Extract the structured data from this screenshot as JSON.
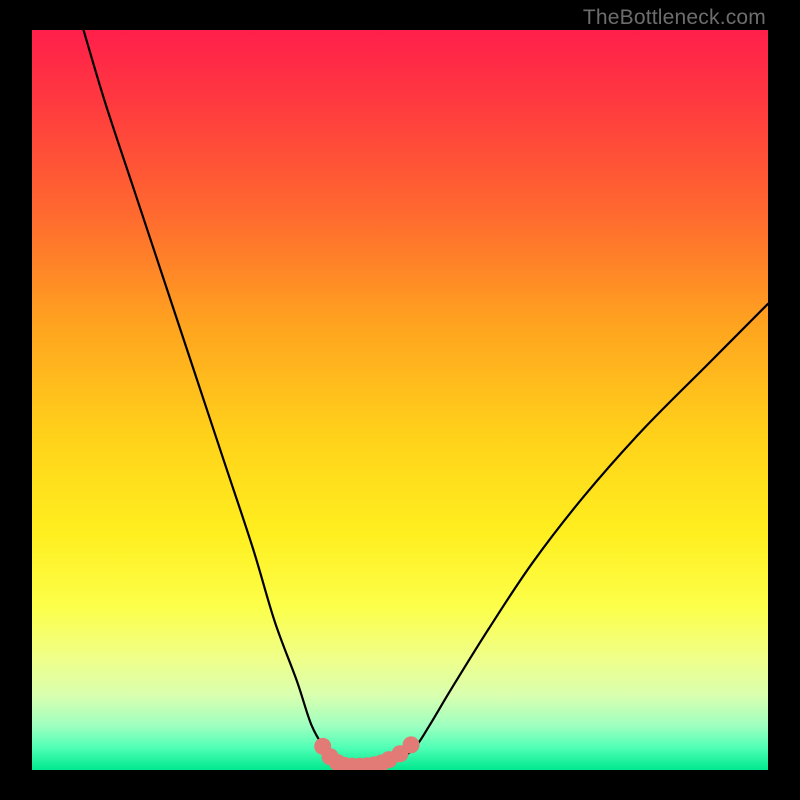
{
  "watermark": {
    "text": "TheBottleneck.com"
  },
  "colors": {
    "page_bg": "#000000",
    "curve_stroke": "#000000",
    "marker_fill": "#e27a76",
    "gradient_stops": [
      "#ff1f4b",
      "#ff3a3f",
      "#ff6a2f",
      "#ffa41f",
      "#ffd21a",
      "#ffef1f",
      "#fcff4a",
      "#efff8a",
      "#d8ffb0",
      "#9fffc0",
      "#4fffb5",
      "#00e98f"
    ]
  },
  "chart_data": {
    "type": "line",
    "title": "",
    "xlabel": "",
    "ylabel": "",
    "xlim": [
      0,
      100
    ],
    "ylim": [
      0,
      100
    ],
    "grid": false,
    "series": [
      {
        "name": "bottleneck-curve",
        "x": [
          7,
          10,
          14,
          18,
          22,
          26,
          30,
          33,
          36,
          38,
          40,
          41,
          42,
          43,
          44,
          46,
          48,
          50,
          52,
          54,
          57,
          62,
          68,
          75,
          83,
          92,
          100
        ],
        "y": [
          100,
          90,
          78,
          66,
          54,
          42,
          30,
          20,
          12,
          6,
          2.5,
          1.2,
          0.7,
          0.5,
          0.5,
          0.6,
          0.9,
          1.6,
          3,
          6,
          11,
          19,
          28,
          37,
          46,
          55,
          63
        ]
      }
    ],
    "markers": {
      "name": "highlight-dots",
      "x": [
        39.5,
        40.5,
        41.5,
        42.5,
        43.5,
        44.5,
        45.5,
        46.5,
        47.5,
        48.5,
        50.0,
        51.5
      ],
      "y": [
        3.2,
        1.8,
        1.0,
        0.6,
        0.5,
        0.5,
        0.55,
        0.7,
        0.95,
        1.4,
        2.2,
        3.4
      ]
    }
  }
}
